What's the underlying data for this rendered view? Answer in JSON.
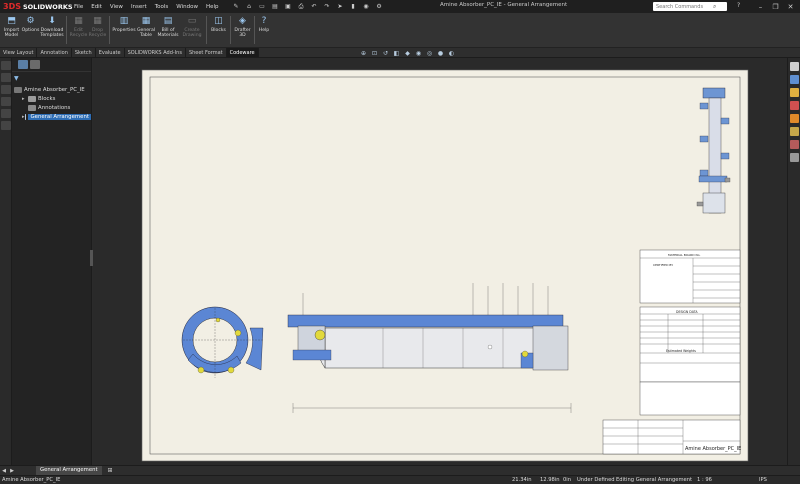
{
  "app": {
    "logo_text": "SOLIDWORKS",
    "logo_mark": "3DS",
    "doc_title": "Amine Absorber_PC_IE - General Arrangement"
  },
  "menu": [
    "File",
    "Edit",
    "View",
    "Insert",
    "Tools",
    "Window",
    "Help"
  ],
  "search": {
    "placeholder": "Search Commands"
  },
  "ribbon": [
    {
      "label": "Import\nModel",
      "disabled": false
    },
    {
      "label": "Options",
      "disabled": false
    },
    {
      "label": "Download\nTemplates",
      "disabled": false
    },
    {
      "label": "Edit\nRecycle",
      "disabled": true
    },
    {
      "label": "Drop\nRecycle",
      "disabled": true
    },
    {
      "label": "Properties",
      "disabled": false
    },
    {
      "label": "General\nTable",
      "disabled": false
    },
    {
      "label": "Bill of\nMaterials",
      "disabled": false
    },
    {
      "label": "Create\nDrawing",
      "disabled": true
    },
    {
      "label": "Blocks",
      "disabled": false
    },
    {
      "label": "Drafter\n3D",
      "disabled": false
    },
    {
      "label": "Help",
      "disabled": false
    }
  ],
  "cm_tabs": [
    "View Layout",
    "Annotation",
    "Sketch",
    "Evaluate",
    "SOLIDWORKS Add-Ins",
    "Sheet Format",
    "Codeware"
  ],
  "cm_active": 6,
  "tree": {
    "root": "Amine Absorber_PC_IE",
    "items": [
      "Blocks",
      "Annotations",
      "General Arrangement"
    ]
  },
  "drawing": {
    "title_block_text": "Amine Absorber_PC_IE",
    "design_data_header": "DESIGN DATA",
    "material_header": "MATERIAL BOARD No.",
    "certified_label": "CERTIFIED BY",
    "estimated_weights": "Estimated Weights",
    "comments": "Comments"
  },
  "sheet": {
    "tab_label": "General Arrangement"
  },
  "status": {
    "doc": "Amine Absorber_PC_IE",
    "x": "21.34in",
    "y": "12.98in",
    "z": "0in",
    "state": "Under Defined",
    "mode": "Editing General Arrangement",
    "scale": "1 : 96",
    "units": "IPS"
  }
}
